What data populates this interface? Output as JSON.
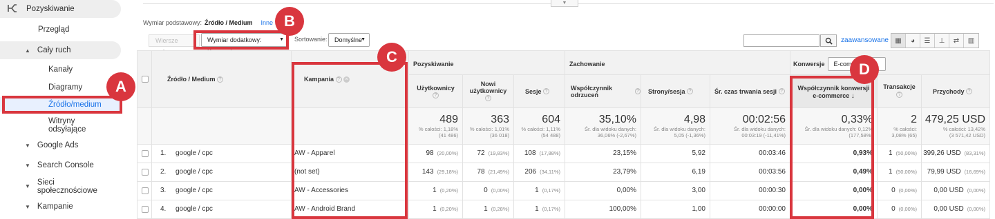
{
  "sidebar": {
    "section": "Pozyskiwanie",
    "items": [
      {
        "label": "Przegląd"
      },
      {
        "label": "Cały ruch"
      },
      {
        "label": "Kanały"
      },
      {
        "label": "Diagramy"
      },
      {
        "label": "Źródło/medium"
      },
      {
        "label": "Witryny odsyłające"
      },
      {
        "label": "Google Ads"
      },
      {
        "label": "Search Console"
      },
      {
        "label": "Sieci społecznościowe"
      },
      {
        "label": "Kampanie"
      }
    ]
  },
  "dimension": {
    "label": "Wymiar podstawowy:",
    "value": "Źródło / Medium",
    "other": "Inne"
  },
  "toolbar": {
    "rows_btn": "Wiersze wykresu",
    "secondary_dim": "Wymiar dodatkowy: Kampania",
    "sort_label": "Sortowanie:",
    "sort_value": "Domyślne",
    "advanced": "zaawansowane"
  },
  "table": {
    "groups": {
      "acq": "Pozyskiwanie",
      "beh": "Zachowanie",
      "conv": "Konwersje",
      "conv_select": "E-commerce"
    },
    "headers": {
      "source": "Źródło / Medium",
      "campaign": "Kampania",
      "users": "Użytkownicy",
      "new_users": "Nowi użytkownicy",
      "sessions": "Sesje",
      "bounce": "Współczynnik odrzuceń",
      "pages": "Strony/sesja",
      "duration": "Śr. czas trwania sesji",
      "conv_rate": "Współczynnik konwersji e-commerce",
      "transactions": "Transakcje",
      "revenue": "Przychody"
    },
    "totals": {
      "users": {
        "big": "489",
        "sub1": "% całości: 1,18%",
        "sub2": "(41 486)"
      },
      "new_users": {
        "big": "363",
        "sub1": "% całości: 1,01%",
        "sub2": "(36 018)"
      },
      "sessions": {
        "big": "604",
        "sub1": "% całości: 1,11%",
        "sub2": "(54 488)"
      },
      "bounce": {
        "big": "35,10%",
        "sub1": "Śr. dla widoku danych:",
        "sub2": "36,06% (-2,67%)"
      },
      "pages": {
        "big": "4,98",
        "sub1": "Śr. dla widoku danych:",
        "sub2": "5,05 (-1,36%)"
      },
      "duration": {
        "big": "00:02:56",
        "sub1": "Śr. dla widoku danych:",
        "sub2": "00:03:19 (-11,41%)"
      },
      "conv_rate": {
        "big": "0,33%",
        "sub1": "Śr. dla widoku danych: 0,12%",
        "sub2": "(177,58%)"
      },
      "transactions": {
        "big": "2",
        "sub1": "% całości:",
        "sub2": "3,08% (65)"
      },
      "revenue": {
        "big": "479,25 USD",
        "sub1": "% całości: 13,42%",
        "sub2": "(3 571,42 USD)"
      }
    },
    "rows": [
      {
        "idx": "1.",
        "source": "google / cpc",
        "campaign": "AW - Apparel",
        "users": "98",
        "users_pct": "(20,00%)",
        "new_users": "72",
        "new_users_pct": "(19,83%)",
        "sessions": "108",
        "sessions_pct": "(17,88%)",
        "bounce": "23,15%",
        "pages": "5,92",
        "duration": "00:03:46",
        "conv_rate": "0,93%",
        "transactions": "1",
        "transactions_pct": "(50,00%)",
        "revenue": "399,26 USD",
        "revenue_pct": "(83,31%)"
      },
      {
        "idx": "2.",
        "source": "google / cpc",
        "campaign": "(not set)",
        "users": "143",
        "users_pct": "(29,18%)",
        "new_users": "78",
        "new_users_pct": "(21,49%)",
        "sessions": "206",
        "sessions_pct": "(34,11%)",
        "bounce": "23,79%",
        "pages": "6,19",
        "duration": "00:03:56",
        "conv_rate": "0,49%",
        "transactions": "1",
        "transactions_pct": "(50,00%)",
        "revenue": "79,99 USD",
        "revenue_pct": "(16,69%)"
      },
      {
        "idx": "3.",
        "source": "google / cpc",
        "campaign": "AW - Accessories",
        "users": "1",
        "users_pct": "(0,20%)",
        "new_users": "0",
        "new_users_pct": "(0,00%)",
        "sessions": "1",
        "sessions_pct": "(0,17%)",
        "bounce": "0,00%",
        "pages": "3,00",
        "duration": "00:00:30",
        "conv_rate": "0,00%",
        "transactions": "0",
        "transactions_pct": "(0,00%)",
        "revenue": "0,00 USD",
        "revenue_pct": "(0,00%)"
      },
      {
        "idx": "4.",
        "source": "google / cpc",
        "campaign": "AW - Android Brand",
        "users": "1",
        "users_pct": "(0,20%)",
        "new_users": "1",
        "new_users_pct": "(0,28%)",
        "sessions": "1",
        "sessions_pct": "(0,17%)",
        "bounce": "100,00%",
        "pages": "1,00",
        "duration": "00:00:00",
        "conv_rate": "0,00%",
        "transactions": "0",
        "transactions_pct": "(0,00%)",
        "revenue": "0,00 USD",
        "revenue_pct": "(0,00%)"
      }
    ]
  },
  "annotations": {
    "a": "A",
    "b": "B",
    "c": "C",
    "d": "D"
  },
  "colors": {
    "accent": "#1a73e8",
    "annotation": "#d9363e",
    "header_bg": "#f2f2f2"
  }
}
